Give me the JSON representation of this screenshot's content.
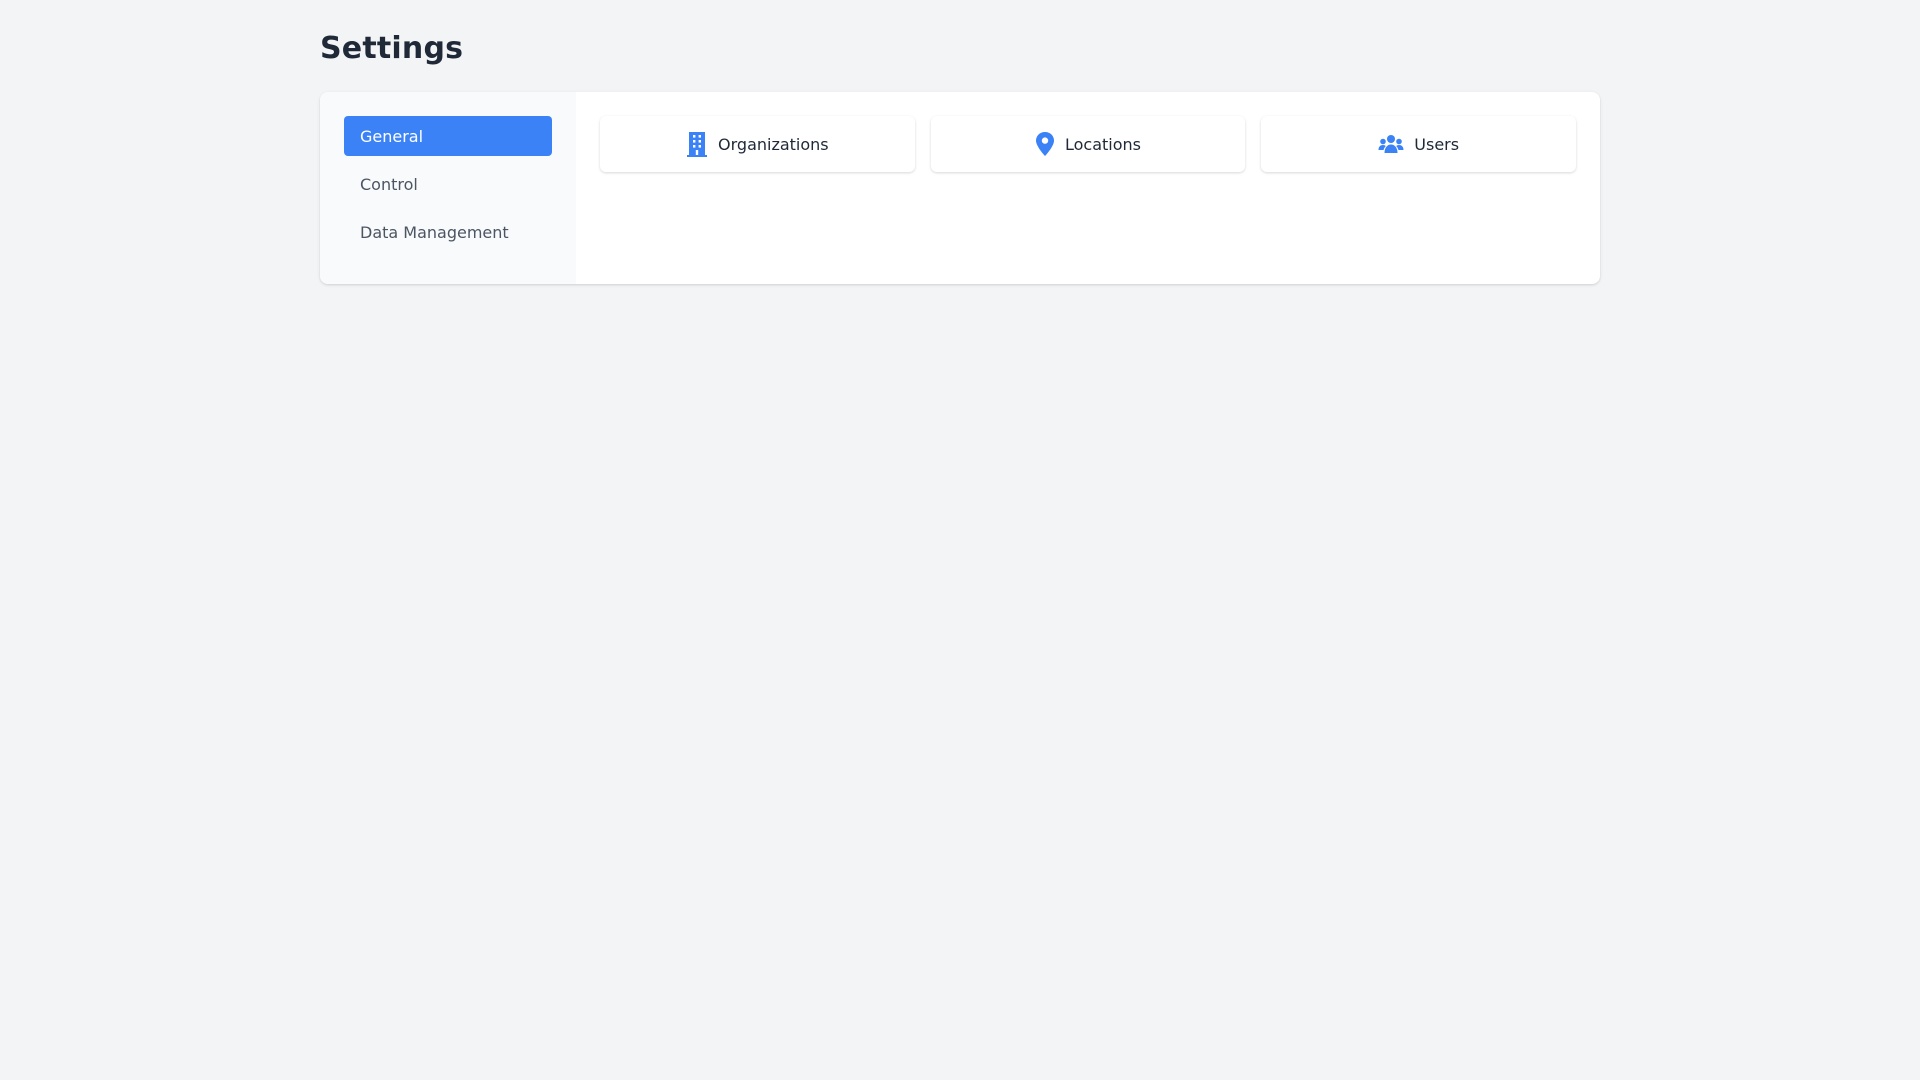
{
  "page": {
    "title": "Settings"
  },
  "sidebar": {
    "items": [
      {
        "label": "General",
        "active": true
      },
      {
        "label": "Control",
        "active": false
      },
      {
        "label": "Data Management",
        "active": false
      }
    ]
  },
  "cards": [
    {
      "label": "Organizations",
      "icon": "building-icon"
    },
    {
      "label": "Locations",
      "icon": "map-pin-icon"
    },
    {
      "label": "Users",
      "icon": "users-icon"
    }
  ],
  "colors": {
    "accent": "#3b82f6",
    "background": "#f3f4f6",
    "sidebar_background": "#f9fafb"
  }
}
